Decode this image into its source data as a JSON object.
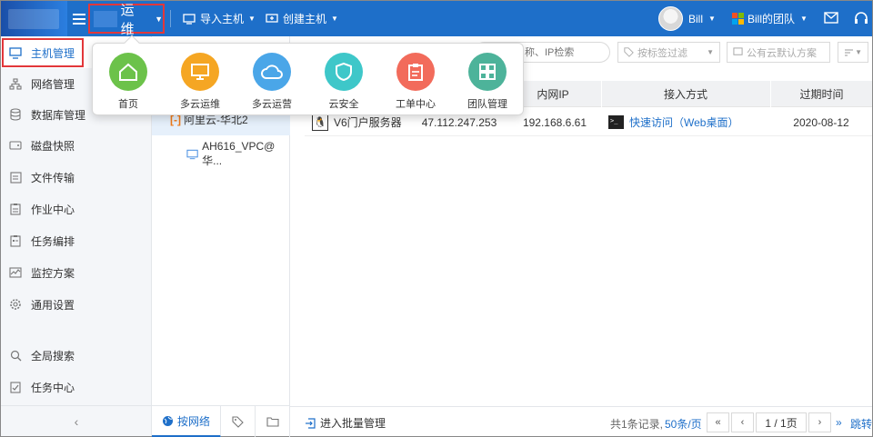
{
  "header": {
    "app_name": "运维",
    "import_host": "导入主机",
    "create_host": "创建主机",
    "user_name": "Bill",
    "team_name": "Bill的团队",
    "colors": {
      "bar": "#1e6fc9",
      "highlight": "#e2373a"
    }
  },
  "sidebar": {
    "items": [
      {
        "label": "主机管理",
        "icon": "monitor-icon"
      },
      {
        "label": "网络管理",
        "icon": "network-icon"
      },
      {
        "label": "数据库管理",
        "icon": "database-icon"
      },
      {
        "label": "磁盘快照",
        "icon": "disk-icon"
      },
      {
        "label": "文件传输",
        "icon": "file-icon"
      },
      {
        "label": "作业中心",
        "icon": "clipboard-icon"
      },
      {
        "label": "任务编排",
        "icon": "task-icon"
      },
      {
        "label": "监控方案",
        "icon": "monitor-chart-icon"
      },
      {
        "label": "通用设置",
        "icon": "gear-icon"
      },
      {
        "label": "全局搜索",
        "icon": "search-icon"
      },
      {
        "label": "任务中心",
        "icon": "task-center-icon"
      }
    ]
  },
  "app_menu": {
    "items": [
      {
        "label": "首页",
        "color": "#6cc24a",
        "icon": "home-icon"
      },
      {
        "label": "多云运维",
        "color": "#f5a623",
        "icon": "display-icon"
      },
      {
        "label": "多云运营",
        "color": "#4aa6e8",
        "icon": "cloud-icon"
      },
      {
        "label": "云安全",
        "color": "#3ec7c9",
        "icon": "shield-icon"
      },
      {
        "label": "工单中心",
        "color": "#f26b5b",
        "icon": "clipboard-icon"
      },
      {
        "label": "团队管理",
        "color": "#4db39a",
        "icon": "grid-icon"
      }
    ]
  },
  "tree": {
    "root_label": "阿里云-华北2",
    "vpc_label": "AH616_VPC@华...",
    "tabs": {
      "network": "按网络"
    }
  },
  "toolbar": {
    "search_placeholder": "名称、IP检索",
    "tag_filter": "按标签过滤",
    "scheme_filter": "公有云默认方案"
  },
  "table": {
    "columns": {
      "intranet_ip": "内网IP",
      "access": "接入方式",
      "expire": "过期时间"
    },
    "rows": [
      {
        "name": "V6门户服务器",
        "public_ip": "47.112.247.253",
        "intranet_ip": "192.168.6.61",
        "access": "快速访问（Web桌面）",
        "expire": "2020-08-12"
      }
    ]
  },
  "footer": {
    "batch_label": "进入批量管理",
    "total": "共1条记录,",
    "per_page": "50条/页",
    "page": "1 / 1页",
    "jump": "跳转"
  }
}
